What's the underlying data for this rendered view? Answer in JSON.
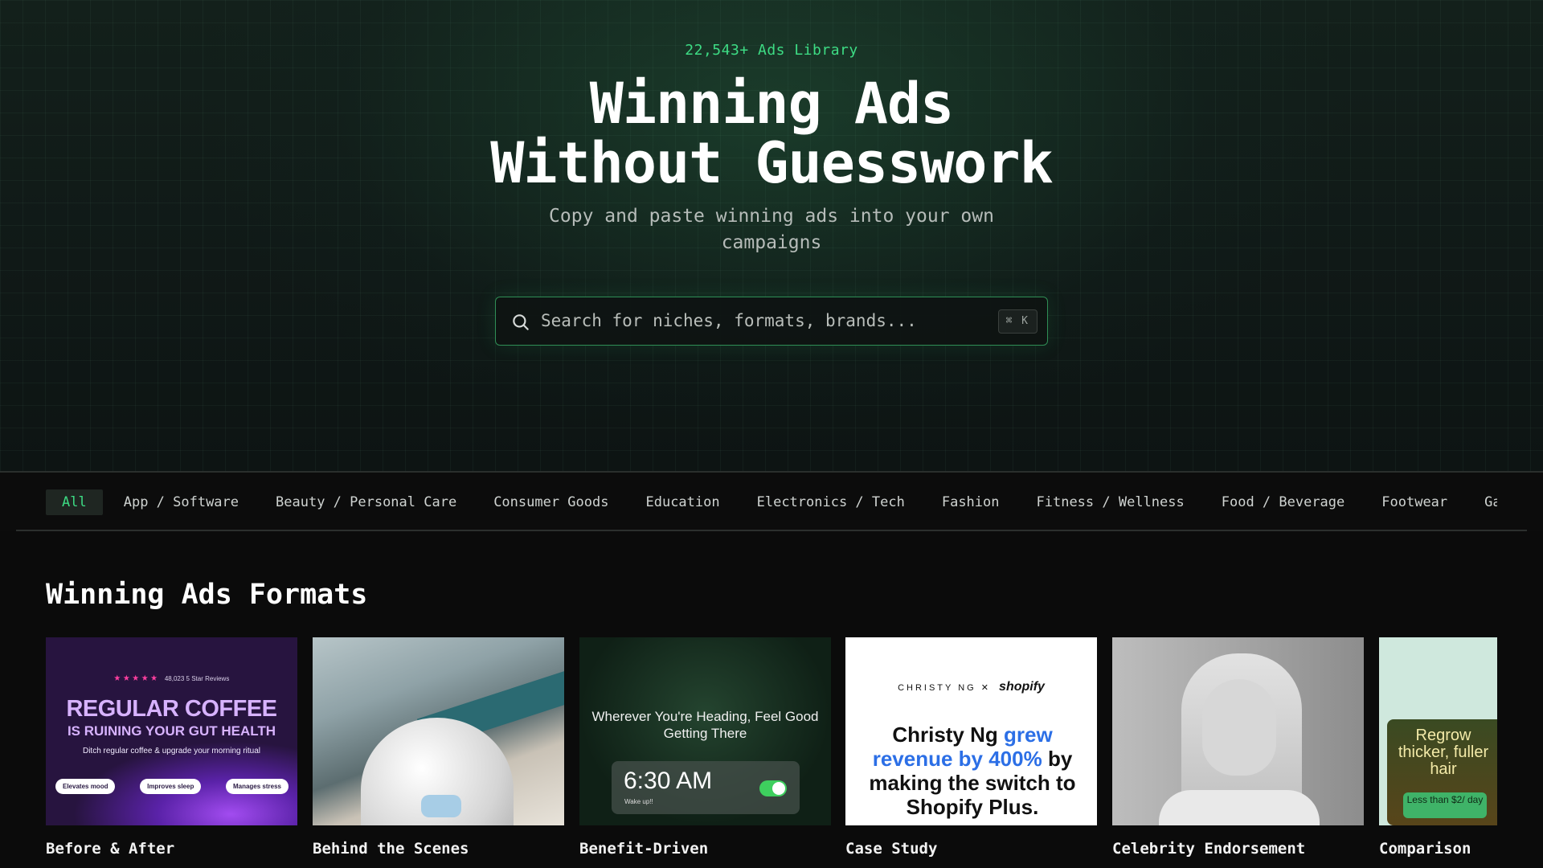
{
  "hero": {
    "eyebrow": "22,543+ Ads Library",
    "title_line1": "Winning Ads",
    "title_line2": "Without Guesswork",
    "subtitle": "Copy and paste winning ads into your own campaigns"
  },
  "search": {
    "placeholder": "Search for niches, formats, brands...",
    "shortcut": "⌘ K",
    "icon": "search-icon"
  },
  "categories": [
    {
      "label": "All",
      "active": true
    },
    {
      "label": "App / Software",
      "active": false
    },
    {
      "label": "Beauty / Personal Care",
      "active": false
    },
    {
      "label": "Consumer Goods",
      "active": false
    },
    {
      "label": "Education",
      "active": false
    },
    {
      "label": "Electronics / Tech",
      "active": false
    },
    {
      "label": "Fashion",
      "active": false
    },
    {
      "label": "Fitness / Wellness",
      "active": false
    },
    {
      "label": "Food / Beverage",
      "active": false
    },
    {
      "label": "Footwear",
      "active": false
    },
    {
      "label": "Games / Toy",
      "active": false
    }
  ],
  "section": {
    "title": "Winning Ads Formats"
  },
  "cards": [
    {
      "label": "Before & After",
      "ad": {
        "stars": "★★★★★",
        "reviews": "48,023 5 Star Reviews",
        "headline1": "REGULAR COFFEE",
        "headline2": "IS RUINING YOUR GUT HEALTH",
        "tagline": "Ditch regular coffee & upgrade your morning ritual",
        "pills": [
          "Elevates mood",
          "Improves sleep",
          "Manages stress"
        ]
      }
    },
    {
      "label": "Behind the Scenes"
    },
    {
      "label": "Benefit-Driven",
      "ad": {
        "headline": "Wherever You're Heading, Feel Good Getting There",
        "time": "6:30 AM",
        "alarm_label": "Wake up!!"
      }
    },
    {
      "label": "Case Study",
      "ad": {
        "brand_left": "CHRISTY NG",
        "brand_sep": "✕",
        "brand_right": "shopify",
        "line_a": "Christy Ng ",
        "line_b": "grew revenue by 400%",
        "line_c": " by making the switch to Shopify Plus."
      }
    },
    {
      "label": "Celebrity Endorsement"
    },
    {
      "label": "Comparison",
      "ad": {
        "headline": "Regrow thicker, fuller hair",
        "price": "Less than $2/ day"
      }
    }
  ],
  "colors": {
    "accent": "#3ddc84",
    "background": "#0b0b0b",
    "search_border": "#2f8e55"
  }
}
